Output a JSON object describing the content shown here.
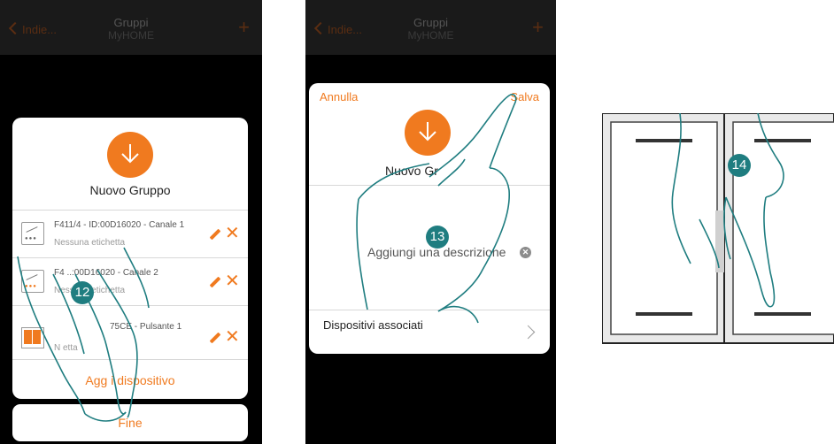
{
  "screen1": {
    "nav": {
      "back_label": "Indie...",
      "title": "Gruppi",
      "subtitle": "MyHOME",
      "add_icon": "+"
    },
    "group_name": "Nuovo Gruppo",
    "devices": [
      {
        "name": "F411/4 - ID:00D16020 - Canale 1",
        "tag": "Nessuna etichetta"
      },
      {
        "name": "F4  ..:00D16020 - Canale 2",
        "tag": "Nessuna etichetta"
      },
      {
        "name": "75CE - Pulsante 1",
        "tag": "N   etta"
      }
    ],
    "add_device_label": "Agg   i dispositivo",
    "done_label": "Fine",
    "step_badge": "12"
  },
  "screen2": {
    "nav": {
      "back_label": "Indie...",
      "title": "Gruppi",
      "subtitle": "MyHOME",
      "add_icon": "+"
    },
    "cancel_label": "Annulla",
    "save_label": "Salva",
    "group_name": "Nuovo Gr",
    "description_placeholder": "Aggiungi una descrizione",
    "associated_devices_label": "Dispositivi associati",
    "step_badge": "13"
  },
  "switch_panel": {
    "step_badge": "14"
  },
  "colors": {
    "accent": "#f07a1f",
    "badge": "#1f7d80",
    "background": "#000000"
  }
}
